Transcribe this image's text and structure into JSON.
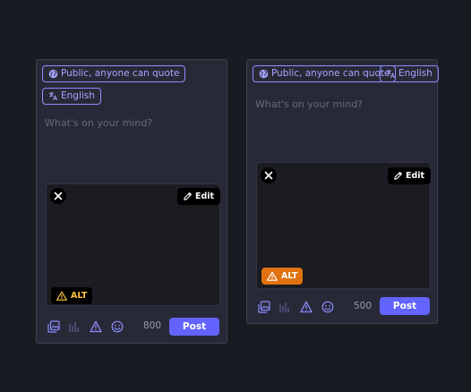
{
  "colors": {
    "background": "#191b22",
    "panel": "#282937",
    "accent": "#6364ff",
    "pill_border": "#8c8dff",
    "alt_warning_text": "#fac13d",
    "alt_warning_bg": "#e0720f"
  },
  "composers": [
    {
      "visibility_label": "Public, anyone can quote",
      "visibility_icon": "globe-icon",
      "language_label": "English",
      "language_icon": "translate-icon",
      "placeholder": "What's on your mind?",
      "media": {
        "close_icon": "close-icon",
        "edit_label": "Edit",
        "edit_icon": "pencil-icon",
        "alt_label": "ALT",
        "alt_icon": "warning-icon",
        "alt_style": "dark"
      },
      "toolbar_icons": [
        "media-icon",
        "poll-icon",
        "content-warning-icon",
        "emoji-icon"
      ],
      "char_count": "800",
      "post_label": "Post"
    },
    {
      "visibility_label": "Public, anyone can quote",
      "visibility_icon": "globe-icon",
      "language_label": "English",
      "language_icon": "translate-icon",
      "placeholder": "What's on your mind?",
      "media": {
        "close_icon": "close-icon",
        "edit_label": "Edit",
        "edit_icon": "pencil-icon",
        "alt_label": "ALT",
        "alt_icon": "warning-icon",
        "alt_style": "orange"
      },
      "toolbar_icons": [
        "media-icon",
        "poll-icon",
        "content-warning-icon",
        "emoji-icon"
      ],
      "char_count": "500",
      "post_label": "Post"
    }
  ]
}
